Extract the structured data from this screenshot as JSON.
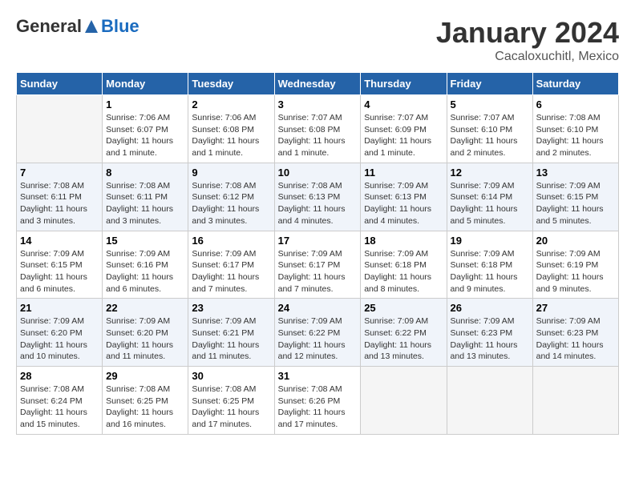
{
  "logo": {
    "general": "General",
    "blue": "Blue"
  },
  "title": "January 2024",
  "location": "Cacaloxuchitl, Mexico",
  "days_of_week": [
    "Sunday",
    "Monday",
    "Tuesday",
    "Wednesday",
    "Thursday",
    "Friday",
    "Saturday"
  ],
  "weeks": [
    [
      {
        "day": "",
        "sunrise": "",
        "sunset": "",
        "daylight": "",
        "empty": true
      },
      {
        "day": "1",
        "sunrise": "Sunrise: 7:06 AM",
        "sunset": "Sunset: 6:07 PM",
        "daylight": "Daylight: 11 hours and 1 minute."
      },
      {
        "day": "2",
        "sunrise": "Sunrise: 7:06 AM",
        "sunset": "Sunset: 6:08 PM",
        "daylight": "Daylight: 11 hours and 1 minute."
      },
      {
        "day": "3",
        "sunrise": "Sunrise: 7:07 AM",
        "sunset": "Sunset: 6:08 PM",
        "daylight": "Daylight: 11 hours and 1 minute."
      },
      {
        "day": "4",
        "sunrise": "Sunrise: 7:07 AM",
        "sunset": "Sunset: 6:09 PM",
        "daylight": "Daylight: 11 hours and 1 minute."
      },
      {
        "day": "5",
        "sunrise": "Sunrise: 7:07 AM",
        "sunset": "Sunset: 6:10 PM",
        "daylight": "Daylight: 11 hours and 2 minutes."
      },
      {
        "day": "6",
        "sunrise": "Sunrise: 7:08 AM",
        "sunset": "Sunset: 6:10 PM",
        "daylight": "Daylight: 11 hours and 2 minutes."
      }
    ],
    [
      {
        "day": "7",
        "sunrise": "Sunrise: 7:08 AM",
        "sunset": "Sunset: 6:11 PM",
        "daylight": "Daylight: 11 hours and 3 minutes."
      },
      {
        "day": "8",
        "sunrise": "Sunrise: 7:08 AM",
        "sunset": "Sunset: 6:11 PM",
        "daylight": "Daylight: 11 hours and 3 minutes."
      },
      {
        "day": "9",
        "sunrise": "Sunrise: 7:08 AM",
        "sunset": "Sunset: 6:12 PM",
        "daylight": "Daylight: 11 hours and 3 minutes."
      },
      {
        "day": "10",
        "sunrise": "Sunrise: 7:08 AM",
        "sunset": "Sunset: 6:13 PM",
        "daylight": "Daylight: 11 hours and 4 minutes."
      },
      {
        "day": "11",
        "sunrise": "Sunrise: 7:09 AM",
        "sunset": "Sunset: 6:13 PM",
        "daylight": "Daylight: 11 hours and 4 minutes."
      },
      {
        "day": "12",
        "sunrise": "Sunrise: 7:09 AM",
        "sunset": "Sunset: 6:14 PM",
        "daylight": "Daylight: 11 hours and 5 minutes."
      },
      {
        "day": "13",
        "sunrise": "Sunrise: 7:09 AM",
        "sunset": "Sunset: 6:15 PM",
        "daylight": "Daylight: 11 hours and 5 minutes."
      }
    ],
    [
      {
        "day": "14",
        "sunrise": "Sunrise: 7:09 AM",
        "sunset": "Sunset: 6:15 PM",
        "daylight": "Daylight: 11 hours and 6 minutes."
      },
      {
        "day": "15",
        "sunrise": "Sunrise: 7:09 AM",
        "sunset": "Sunset: 6:16 PM",
        "daylight": "Daylight: 11 hours and 6 minutes."
      },
      {
        "day": "16",
        "sunrise": "Sunrise: 7:09 AM",
        "sunset": "Sunset: 6:17 PM",
        "daylight": "Daylight: 11 hours and 7 minutes."
      },
      {
        "day": "17",
        "sunrise": "Sunrise: 7:09 AM",
        "sunset": "Sunset: 6:17 PM",
        "daylight": "Daylight: 11 hours and 7 minutes."
      },
      {
        "day": "18",
        "sunrise": "Sunrise: 7:09 AM",
        "sunset": "Sunset: 6:18 PM",
        "daylight": "Daylight: 11 hours and 8 minutes."
      },
      {
        "day": "19",
        "sunrise": "Sunrise: 7:09 AM",
        "sunset": "Sunset: 6:18 PM",
        "daylight": "Daylight: 11 hours and 9 minutes."
      },
      {
        "day": "20",
        "sunrise": "Sunrise: 7:09 AM",
        "sunset": "Sunset: 6:19 PM",
        "daylight": "Daylight: 11 hours and 9 minutes."
      }
    ],
    [
      {
        "day": "21",
        "sunrise": "Sunrise: 7:09 AM",
        "sunset": "Sunset: 6:20 PM",
        "daylight": "Daylight: 11 hours and 10 minutes."
      },
      {
        "day": "22",
        "sunrise": "Sunrise: 7:09 AM",
        "sunset": "Sunset: 6:20 PM",
        "daylight": "Daylight: 11 hours and 11 minutes."
      },
      {
        "day": "23",
        "sunrise": "Sunrise: 7:09 AM",
        "sunset": "Sunset: 6:21 PM",
        "daylight": "Daylight: 11 hours and 11 minutes."
      },
      {
        "day": "24",
        "sunrise": "Sunrise: 7:09 AM",
        "sunset": "Sunset: 6:22 PM",
        "daylight": "Daylight: 11 hours and 12 minutes."
      },
      {
        "day": "25",
        "sunrise": "Sunrise: 7:09 AM",
        "sunset": "Sunset: 6:22 PM",
        "daylight": "Daylight: 11 hours and 13 minutes."
      },
      {
        "day": "26",
        "sunrise": "Sunrise: 7:09 AM",
        "sunset": "Sunset: 6:23 PM",
        "daylight": "Daylight: 11 hours and 13 minutes."
      },
      {
        "day": "27",
        "sunrise": "Sunrise: 7:09 AM",
        "sunset": "Sunset: 6:23 PM",
        "daylight": "Daylight: 11 hours and 14 minutes."
      }
    ],
    [
      {
        "day": "28",
        "sunrise": "Sunrise: 7:08 AM",
        "sunset": "Sunset: 6:24 PM",
        "daylight": "Daylight: 11 hours and 15 minutes."
      },
      {
        "day": "29",
        "sunrise": "Sunrise: 7:08 AM",
        "sunset": "Sunset: 6:25 PM",
        "daylight": "Daylight: 11 hours and 16 minutes."
      },
      {
        "day": "30",
        "sunrise": "Sunrise: 7:08 AM",
        "sunset": "Sunset: 6:25 PM",
        "daylight": "Daylight: 11 hours and 17 minutes."
      },
      {
        "day": "31",
        "sunrise": "Sunrise: 7:08 AM",
        "sunset": "Sunset: 6:26 PM",
        "daylight": "Daylight: 11 hours and 17 minutes."
      },
      {
        "day": "",
        "sunrise": "",
        "sunset": "",
        "daylight": "",
        "empty": true
      },
      {
        "day": "",
        "sunrise": "",
        "sunset": "",
        "daylight": "",
        "empty": true
      },
      {
        "day": "",
        "sunrise": "",
        "sunset": "",
        "daylight": "",
        "empty": true
      }
    ]
  ]
}
